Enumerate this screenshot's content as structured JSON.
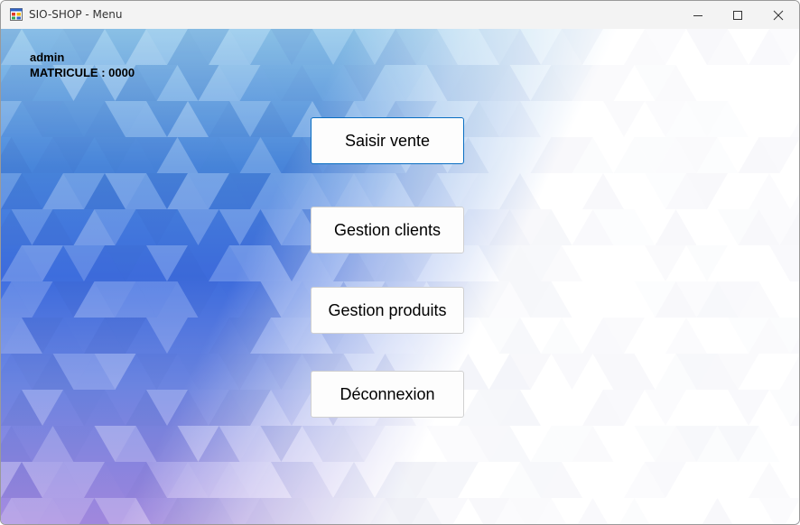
{
  "window": {
    "title": "SIO-SHOP - Menu"
  },
  "user": {
    "name": "admin",
    "matricule": "MATRICULE : 0000"
  },
  "menu": {
    "saisir_vente": "Saisir vente",
    "gestion_clients": "Gestion clients",
    "gestion_produits": "Gestion produits",
    "deconnexion": "Déconnexion"
  },
  "colors": {
    "focus_border": "#0a6ec2",
    "gradient_top": "#8fc6ea",
    "gradient_mid": "#3f6fe0",
    "gradient_bottom": "#a68ae0"
  },
  "icons": {
    "app": "windows-forms-app-icon",
    "minimize": "minimize-icon",
    "maximize": "maximize-icon",
    "close": "close-icon"
  }
}
